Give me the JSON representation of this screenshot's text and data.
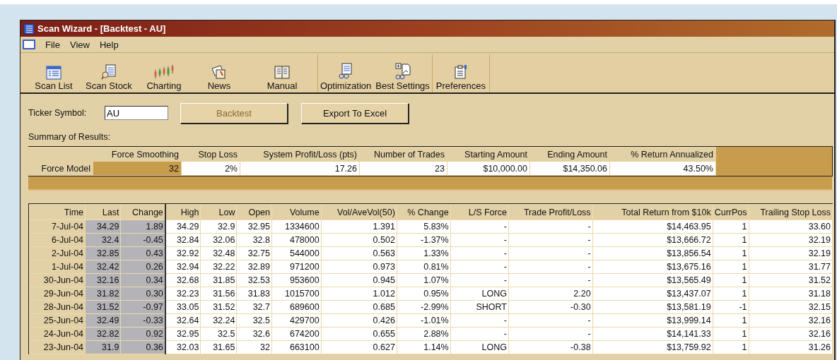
{
  "window": {
    "title": "Scan Wizard - [Backtest - AU]"
  },
  "menu": [
    "File",
    "View",
    "Help"
  ],
  "toolbar": [
    {
      "label": "Scan List",
      "kind": "list"
    },
    {
      "label": "Scan Stock",
      "kind": "scan"
    },
    {
      "label": "Charting",
      "kind": "chart"
    },
    {
      "label": "News",
      "kind": "news"
    },
    {
      "label": "Manual",
      "kind": "book"
    },
    {
      "label": "Optimization",
      "kind": "optimize"
    },
    {
      "label": "Best Settings",
      "kind": "best"
    },
    {
      "label": "Preferences",
      "kind": "prefs"
    }
  ],
  "ticker": {
    "label": "Ticker Symbol:",
    "value": "AU"
  },
  "buttons": [
    {
      "label": "Backtest",
      "disabled": true
    },
    {
      "label": "Export To Excel",
      "disabled": false
    }
  ],
  "summary": {
    "title": "Summary of Results:",
    "columns": [
      "Force Smoothing",
      "Stop Loss",
      "System Profit/Loss (pts)",
      "Number of Trades",
      "Starting Amount",
      "Ending Amount",
      "% Return Annualized"
    ],
    "row": {
      "label": "Force Model",
      "cells": [
        {
          "value": "32",
          "selected": true
        },
        {
          "value": "2%",
          "selected": false
        },
        {
          "value": "17.26",
          "selected": false
        },
        {
          "value": "23",
          "selected": false
        },
        {
          "value": "$10,000.00",
          "selected": false
        },
        {
          "value": "$14,350.06",
          "selected": false
        },
        {
          "value": "43.50%",
          "selected": false
        }
      ]
    }
  },
  "table": {
    "columns": [
      {
        "label": "Time",
        "kind": "header"
      },
      {
        "label": "Last",
        "kind": "grey"
      },
      {
        "label": "Change",
        "kind": "grey"
      },
      {
        "label": "High",
        "kind": "plain"
      },
      {
        "label": "Low",
        "kind": "plain"
      },
      {
        "label": "Open",
        "kind": "plain"
      },
      {
        "label": "Volume",
        "kind": "plain"
      },
      {
        "label": "Vol/AveVol(50)",
        "kind": "plain"
      },
      {
        "label": "% Change",
        "kind": "plain"
      },
      {
        "label": "L/S Force",
        "kind": "plain"
      },
      {
        "label": "Trade Profit/Loss",
        "kind": "plain"
      },
      {
        "label": "Total Return from $10k",
        "kind": "plain"
      },
      {
        "label": "CurrPos",
        "kind": "plain"
      },
      {
        "label": "Trailing Stop Loss",
        "kind": "plain"
      }
    ],
    "rows": [
      [
        "7-Jul-04",
        "34.29",
        "1.89",
        "34.29",
        "32.9",
        "32.95",
        "1334600",
        "1.391",
        "5.83%",
        "-",
        "-",
        "$14,463.95",
        "1",
        "33.60"
      ],
      [
        "6-Jul-04",
        "32.4",
        "-0.45",
        "32.84",
        "32.06",
        "32.8",
        "478000",
        "0.502",
        "-1.37%",
        "-",
        "-",
        "$13,666.72",
        "1",
        "32.19"
      ],
      [
        "2-Jul-04",
        "32.85",
        "0.43",
        "32.92",
        "32.48",
        "32.75",
        "544000",
        "0.563",
        "1.33%",
        "-",
        "-",
        "$13,856.54",
        "1",
        "32.19"
      ],
      [
        "1-Jul-04",
        "32.42",
        "0.26",
        "32.94",
        "32.22",
        "32.89",
        "971200",
        "0.973",
        "0.81%",
        "-",
        "-",
        "$13,675.16",
        "1",
        "31.77"
      ],
      [
        "30-Jun-04",
        "32.16",
        "0.34",
        "32.68",
        "31.85",
        "32.53",
        "953600",
        "0.945",
        "1.07%",
        "-",
        "-",
        "$13,565.49",
        "1",
        "31.52"
      ],
      [
        "29-Jun-04",
        "31.82",
        "0.30",
        "32.23",
        "31.56",
        "31.83",
        "1015700",
        "1.012",
        "0.95%",
        "LONG",
        "2.20",
        "$13,437.07",
        "1",
        "31.18"
      ],
      [
        "28-Jun-04",
        "31.52",
        "-0.97",
        "33.05",
        "31.52",
        "32.7",
        "689600",
        "0.685",
        "-2.99%",
        "SHORT",
        "-0.30",
        "$13,581.19",
        "-1",
        "32.15"
      ],
      [
        "25-Jun-04",
        "32.49",
        "-0.33",
        "32.64",
        "32.24",
        "32.5",
        "429700",
        "0.426",
        "-1.01%",
        "-",
        "-",
        "$13,999.14",
        "1",
        "32.16"
      ],
      [
        "24-Jun-04",
        "32.82",
        "0.92",
        "32.95",
        "32.5",
        "32.6",
        "674200",
        "0.655",
        "2.88%",
        "-",
        "-",
        "$14,141.33",
        "1",
        "32.16"
      ],
      [
        "23-Jun-04",
        "31.9",
        "0.36",
        "32.03",
        "31.65",
        "32",
        "663100",
        "0.627",
        "1.14%",
        "LONG",
        "-0.38",
        "$13,759.92",
        "1",
        "31.26"
      ]
    ]
  }
}
